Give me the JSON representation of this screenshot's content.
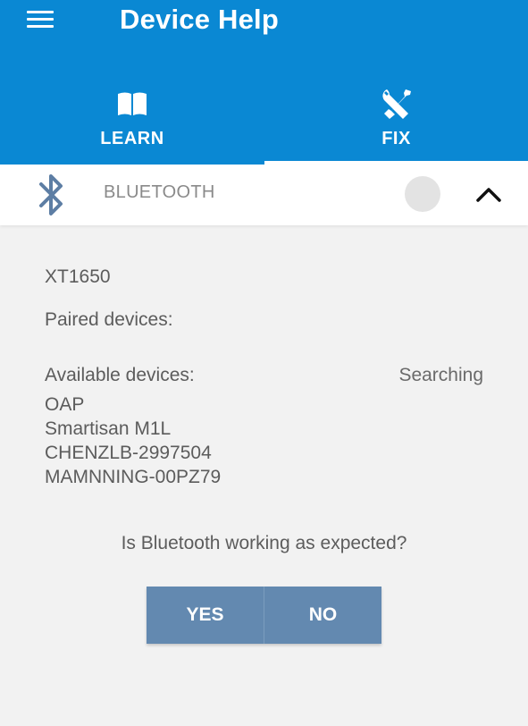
{
  "header": {
    "title": "Device Help",
    "menu_icon": "menu-icon"
  },
  "tabs": [
    {
      "label": "LEARN",
      "icon": "book-icon",
      "selected": false
    },
    {
      "label": "FIX",
      "icon": "wrench-screwdriver-icon",
      "selected": true
    }
  ],
  "bluetooth": {
    "label": "BLUETOOTH",
    "icon": "bluetooth-icon",
    "toggle_on": false,
    "expanded": true
  },
  "details": {
    "device_name": "XT1650",
    "paired_label": "Paired devices:",
    "available_label": "Available devices:",
    "status": "Searching",
    "available_devices": [
      "OAP",
      "Smartisan M1L",
      "CHENZLB-2997504",
      "MAMNNING-00PZ79"
    ]
  },
  "prompt": {
    "question": "Is Bluetooth working as expected?",
    "yes_label": "YES",
    "no_label": "NO"
  },
  "colors": {
    "app_bar": "#0a88d3",
    "button": "#6389b0",
    "bluetooth_icon": "#5d7ea4",
    "background": "#f2f2f2"
  }
}
